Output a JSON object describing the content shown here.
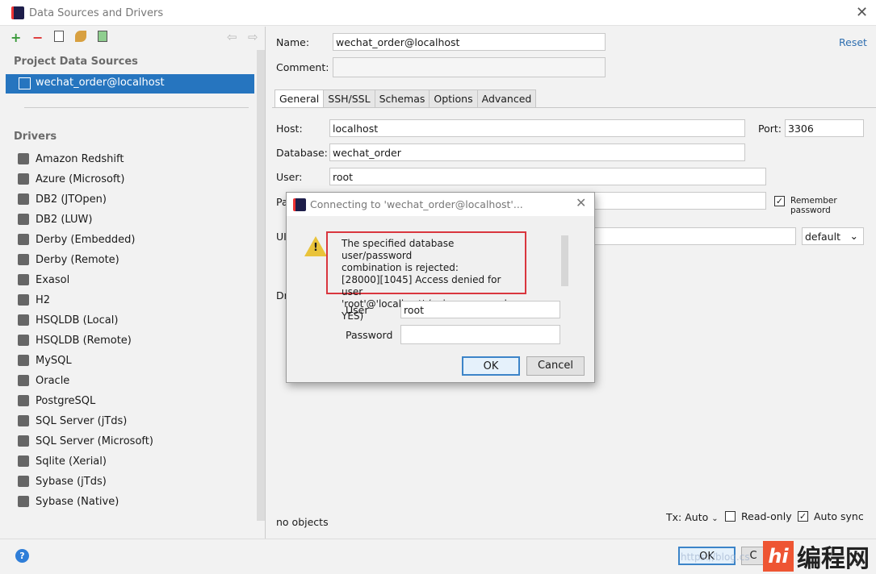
{
  "window": {
    "title": "Data Sources and Drivers"
  },
  "toolbar": {
    "add": "+",
    "remove": "−",
    "copy": "copy",
    "properties": "properties",
    "import": "import",
    "back": "⇦",
    "forward": "⇨"
  },
  "sidebar": {
    "project_heading": "Project Data Sources",
    "selected_source": "wechat_order@localhost",
    "drivers_heading": "Drivers",
    "drivers": [
      "Amazon Redshift",
      "Azure (Microsoft)",
      "DB2 (JTOpen)",
      "DB2 (LUW)",
      "Derby (Embedded)",
      "Derby (Remote)",
      "Exasol",
      "H2",
      "HSQLDB (Local)",
      "HSQLDB (Remote)",
      "MySQL",
      "Oracle",
      "PostgreSQL",
      "SQL Server (jTds)",
      "SQL Server (Microsoft)",
      "Sqlite (Xerial)",
      "Sybase (jTds)",
      "Sybase (Native)"
    ]
  },
  "form": {
    "name_label": "Name:",
    "name_value": "wechat_order@localhost",
    "comment_label": "Comment:",
    "reset": "Reset",
    "tabs": [
      "General",
      "SSH/SSL",
      "Schemas",
      "Options",
      "Advanced"
    ],
    "host_label": "Host:",
    "host_value": "localhost",
    "port_label": "Port:",
    "port_value": "3306",
    "database_label": "Database:",
    "database_value": "wechat_order",
    "user_label": "User:",
    "user_value": "root",
    "password_label_partial": "Pa",
    "remember_password": "Remember password",
    "url_label_partial": "UI",
    "url_mode": "default",
    "driver_label_partial": "Dr"
  },
  "status": {
    "objects": "no objects",
    "tx": "Tx: Auto",
    "read_only": "Read-only",
    "auto_sync": "Auto sync",
    "read_only_checked": false,
    "auto_sync_checked": true,
    "remember_checked": true
  },
  "footer": {
    "ok": "OK",
    "cancel_partial": "C",
    "help": "?"
  },
  "dialog": {
    "title": "Connecting to 'wechat_order@localhost'...",
    "error_lines": [
      "The specified database user/password",
      "combination is rejected:",
      "[28000][1045] Access denied for user",
      "'root'@'localhost' (using password: YES)"
    ],
    "user_label": "User",
    "user_value": "root",
    "password_label": "Password",
    "password_value": "",
    "ok": "OK",
    "cancel": "Cancel"
  },
  "watermark": {
    "text": "编程网",
    "overlay": "https://blog.cs"
  },
  "colors": {
    "selection": "#2675bf",
    "error_border": "#d9363e",
    "link": "#2f6fb0"
  }
}
